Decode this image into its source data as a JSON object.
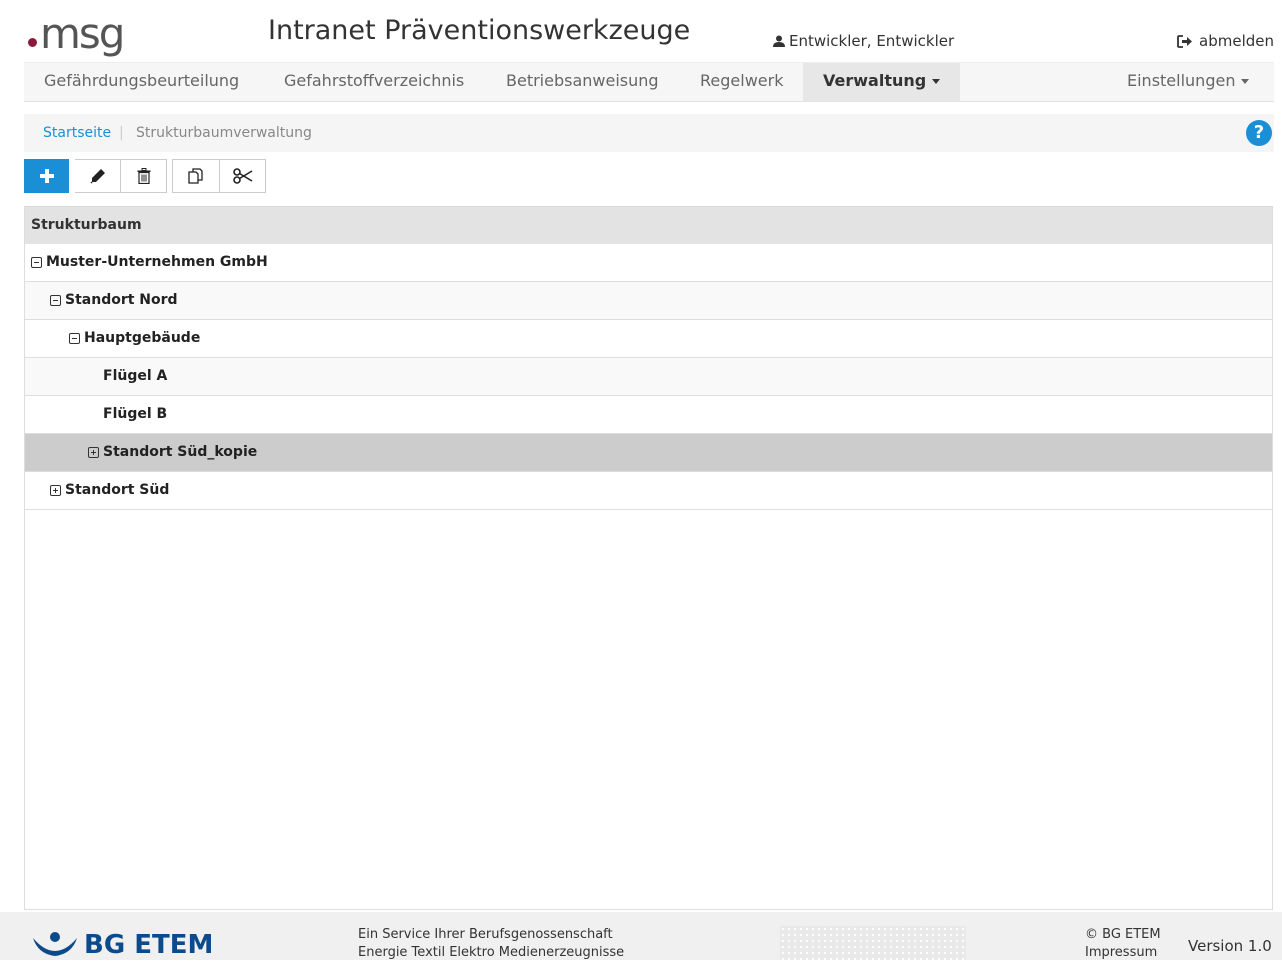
{
  "header": {
    "logo_text": "msg",
    "app_title": "Intranet Präventionswerkzeuge",
    "user_name": "Entwickler, Entwickler",
    "logout_label": "abmelden"
  },
  "nav": {
    "items": [
      {
        "label": "Gefährdungsbeurteilung"
      },
      {
        "label": "Gefahrstoffverzeichnis"
      },
      {
        "label": "Betriebsanweisung"
      },
      {
        "label": "Regelwerk"
      },
      {
        "label": "Verwaltung",
        "active": true,
        "dropdown": true
      }
    ],
    "settings_label": "Einstellungen"
  },
  "breadcrumb": {
    "home": "Startseite",
    "separator": "|",
    "current": "Strukturbaumverwaltung",
    "help_label": "?"
  },
  "toolbar": {
    "buttons": [
      {
        "icon": "plus-icon"
      },
      {
        "icon": "pencil-icon"
      },
      {
        "icon": "trash-icon"
      },
      {
        "icon": "copy-icon"
      },
      {
        "icon": "scissors-icon"
      }
    ]
  },
  "tree": {
    "header": "Strukturbaum",
    "rows": [
      {
        "label": "Muster-Unternehmen GmbH",
        "level": 0,
        "toggle": "minus"
      },
      {
        "label": "Standort Nord",
        "level": 1,
        "toggle": "minus"
      },
      {
        "label": "Hauptgebäude",
        "level": 2,
        "toggle": "minus"
      },
      {
        "label": "Flügel A",
        "level": 3,
        "toggle": "none"
      },
      {
        "label": "Flügel B",
        "level": 3,
        "toggle": "none"
      },
      {
        "label": "Standort Süd_kopie",
        "level": 3,
        "toggle": "plus",
        "selected": true
      },
      {
        "label": "Standort Süd",
        "level": 1,
        "toggle": "plus"
      }
    ]
  },
  "footer": {
    "org_name": "BG ETEM",
    "service_line1": "Ein Service Ihrer Berufsgenossenschaft",
    "service_line2": "Energie Textil Elektro Medienerzeugnisse",
    "copyright": "© BG ETEM",
    "impressum": "Impressum",
    "version": "Version 1.0"
  },
  "colors": {
    "accent": "#1b8fd6",
    "brand_dot": "#8a1a3a",
    "bg_etem_blue": "#0b4a8b",
    "selected_row": "#cccccc"
  }
}
